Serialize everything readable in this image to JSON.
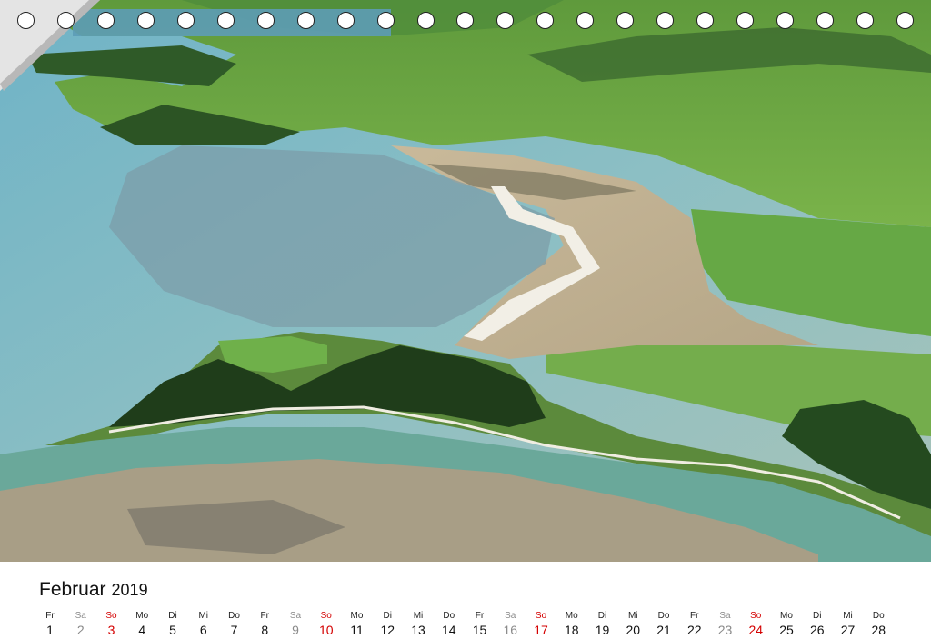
{
  "calendar": {
    "month": "Februar",
    "year": "2019",
    "days": [
      {
        "wd": "Fr",
        "d": "1",
        "type": "weekday"
      },
      {
        "wd": "Sa",
        "d": "2",
        "type": "sat"
      },
      {
        "wd": "So",
        "d": "3",
        "type": "sun"
      },
      {
        "wd": "Mo",
        "d": "4",
        "type": "weekday"
      },
      {
        "wd": "Di",
        "d": "5",
        "type": "weekday"
      },
      {
        "wd": "Mi",
        "d": "6",
        "type": "weekday"
      },
      {
        "wd": "Do",
        "d": "7",
        "type": "weekday"
      },
      {
        "wd": "Fr",
        "d": "8",
        "type": "weekday"
      },
      {
        "wd": "Sa",
        "d": "9",
        "type": "sat"
      },
      {
        "wd": "So",
        "d": "10",
        "type": "sun"
      },
      {
        "wd": "Mo",
        "d": "11",
        "type": "weekday"
      },
      {
        "wd": "Di",
        "d": "12",
        "type": "weekday"
      },
      {
        "wd": "Mi",
        "d": "13",
        "type": "weekday"
      },
      {
        "wd": "Do",
        "d": "14",
        "type": "weekday"
      },
      {
        "wd": "Fr",
        "d": "15",
        "type": "weekday"
      },
      {
        "wd": "Sa",
        "d": "16",
        "type": "sat"
      },
      {
        "wd": "So",
        "d": "17",
        "type": "sun"
      },
      {
        "wd": "Mo",
        "d": "18",
        "type": "weekday"
      },
      {
        "wd": "Di",
        "d": "19",
        "type": "weekday"
      },
      {
        "wd": "Mi",
        "d": "20",
        "type": "weekday"
      },
      {
        "wd": "Do",
        "d": "21",
        "type": "weekday"
      },
      {
        "wd": "Fr",
        "d": "22",
        "type": "weekday"
      },
      {
        "wd": "Sa",
        "d": "23",
        "type": "sat"
      },
      {
        "wd": "So",
        "d": "24",
        "type": "sun"
      },
      {
        "wd": "Mo",
        "d": "25",
        "type": "weekday"
      },
      {
        "wd": "Di",
        "d": "26",
        "type": "weekday"
      },
      {
        "wd": "Mi",
        "d": "27",
        "type": "weekday"
      },
      {
        "wd": "Do",
        "d": "28",
        "type": "weekday"
      }
    ]
  },
  "colors": {
    "sunday": "#d40000",
    "saturday": "#8a8a8a"
  }
}
